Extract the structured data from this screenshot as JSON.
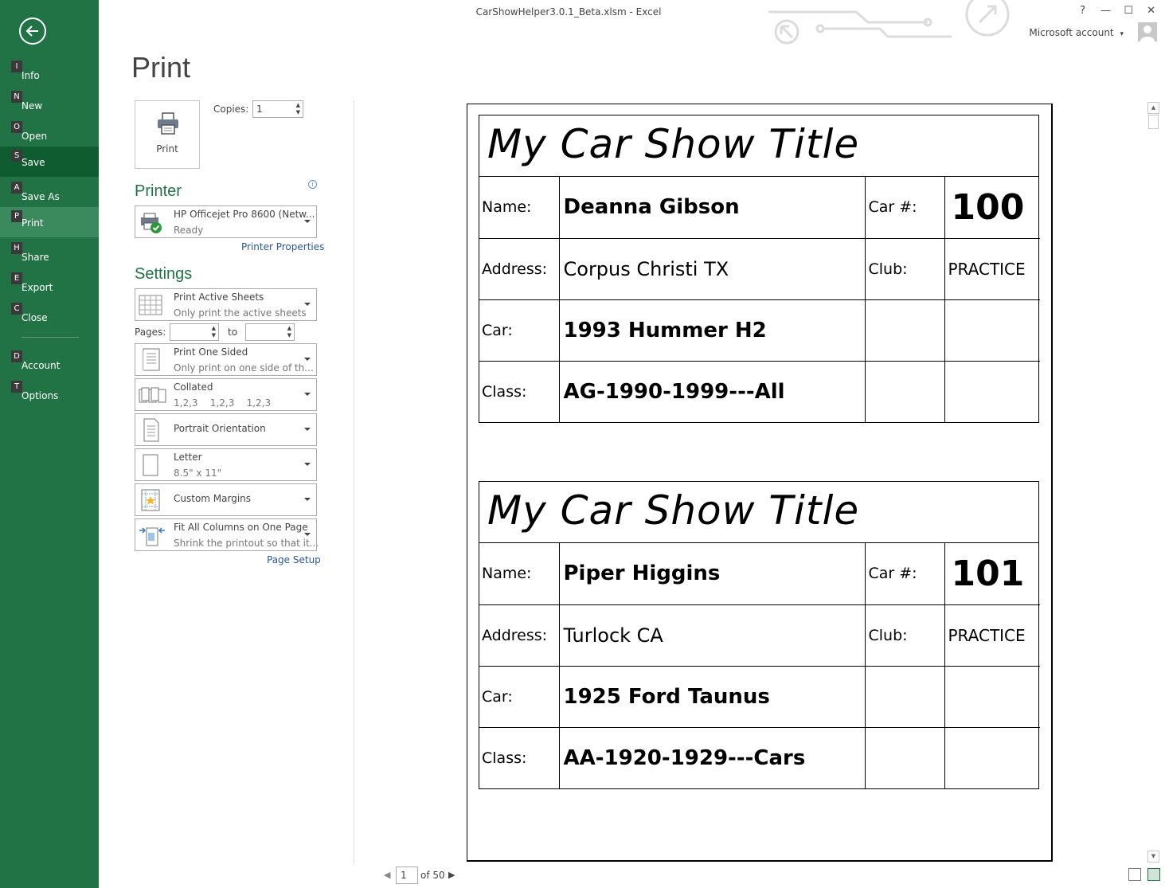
{
  "window": {
    "title": "CarShowHelper3.0.1_Beta.xlsm - Excel",
    "help": "?",
    "minimize": "—",
    "maximize": "☐",
    "close": "✕",
    "account": "Microsoft account",
    "account_caret": "▾"
  },
  "nav": {
    "items": [
      {
        "key": "I",
        "label": "Info"
      },
      {
        "key": "N",
        "label": "New"
      },
      {
        "key": "O",
        "label": "Open"
      },
      {
        "key": "S",
        "label": "Save"
      },
      {
        "key": "A",
        "label": "Save As"
      },
      {
        "key": "P",
        "label": "Print"
      },
      {
        "key": "H",
        "label": "Share"
      },
      {
        "key": "E",
        "label": "Export"
      },
      {
        "key": "C",
        "label": "Close"
      },
      {
        "key": "D",
        "label": "Account"
      },
      {
        "key": "T",
        "label": "Options"
      }
    ]
  },
  "print": {
    "heading": "Print",
    "button": "Print",
    "copies_label": "Copies:",
    "copies_value": "1",
    "printer_heading": "Printer",
    "printer_name": "HP Officejet Pro 8600 (Netw...",
    "printer_status": "Ready",
    "printer_properties": "Printer Properties",
    "settings_heading": "Settings",
    "settings": [
      {
        "l1": "Print Active Sheets",
        "l2": "Only print the active sheets"
      },
      {
        "l1": "Print One Sided",
        "l2": "Only print on one side of th..."
      },
      {
        "l1": "Collated",
        "l2": "1,2,3    1,2,3    1,2,3"
      },
      {
        "l1": "Portrait Orientation",
        "l2": ""
      },
      {
        "l1": "Letter",
        "l2": "8.5\" x 11\""
      },
      {
        "l1": "Custom Margins",
        "l2": ""
      },
      {
        "l1": "Fit All Columns on One Page",
        "l2": "Shrink the printout so that it..."
      }
    ],
    "pages_label": "Pages:",
    "pages_from": "",
    "to_label": "to",
    "pages_to": "",
    "page_setup": "Page Setup"
  },
  "preview": {
    "cards": [
      {
        "title": "My Car Show Title",
        "name_label": "Name:",
        "name": "Deanna Gibson",
        "carnum_label": "Car #:",
        "carnum": "100",
        "address_label": "Address:",
        "address": "Corpus Christi TX",
        "club_label": "Club:",
        "club": "PRACTICE",
        "car_label": "Car:",
        "car": "1993 Hummer H2",
        "class_label": "Class:",
        "class": "AG-1990-1999---All"
      },
      {
        "title": "My Car Show Title",
        "name_label": "Name:",
        "name": "Piper Higgins",
        "carnum_label": "Car #:",
        "carnum": "101",
        "address_label": "Address:",
        "address": "Turlock CA",
        "club_label": "Club:",
        "club": "PRACTICE",
        "car_label": "Car:",
        "car": "1925 Ford Taunus",
        "class_label": "Class:",
        "class": "AA-1920-1929---Cars"
      }
    ]
  },
  "pager": {
    "prev": "◀",
    "current": "1",
    "of_label": "of 50",
    "next": "▶"
  },
  "scroll": {
    "up": "▲",
    "down": "▼"
  },
  "colors": {
    "accent": "#217346",
    "selected_nav": "#3b8a5e",
    "save_nav": "#0e5c2f"
  }
}
